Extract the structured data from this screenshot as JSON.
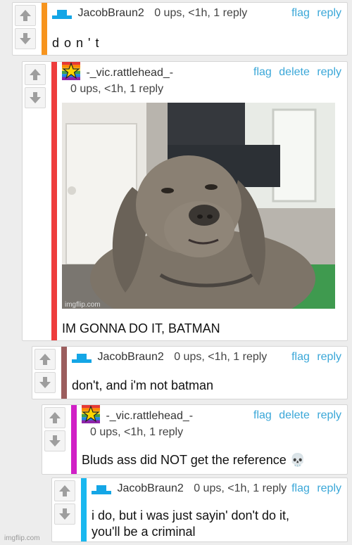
{
  "colors": {
    "link": "#3aa7d8",
    "stripe_orange": "#f7941d",
    "stripe_red": "#ee3c3c",
    "stripe_brown": "#9b5d5d",
    "stripe_magenta": "#d11fc6",
    "stripe_blue": "#19b8f0"
  },
  "icons": {
    "upvote": "arrow-up-icon",
    "downvote": "arrow-down-icon",
    "avatar_default": "blue-tray-avatar-icon",
    "avatar_star": "rainbow-star-avatar-icon"
  },
  "comments": [
    {
      "user": "JacobBraun2",
      "stats": "0 ups, <1h, 1 reply",
      "actions": [
        "flag",
        "reply"
      ],
      "text": "d o n ' t"
    },
    {
      "user": "-_vic.rattlehead_-",
      "stats": "0 ups, <1h, 1 reply",
      "actions": [
        "flag",
        "delete",
        "reply"
      ],
      "image_watermark": "imgflip.com",
      "text": "IM GONNA DO IT, BATMAN"
    },
    {
      "user": "JacobBraun2",
      "stats": "0 ups, <1h, 1 reply",
      "actions": [
        "flag",
        "reply"
      ],
      "text": "don't, and i'm not batman"
    },
    {
      "user": "-_vic.rattlehead_-",
      "stats": "0 ups, <1h, 1 reply",
      "actions": [
        "flag",
        "delete",
        "reply"
      ],
      "text": "Bluds ass did NOT get the reference 💀"
    },
    {
      "user": "JacobBraun2",
      "stats": "0 ups, <1h, 1 reply",
      "actions": [
        "flag",
        "reply"
      ],
      "text_line1": "i do, but i was just sayin' don't do it,",
      "text_line2": "you'll be a criminal"
    }
  ],
  "footer": "imgflip.com"
}
